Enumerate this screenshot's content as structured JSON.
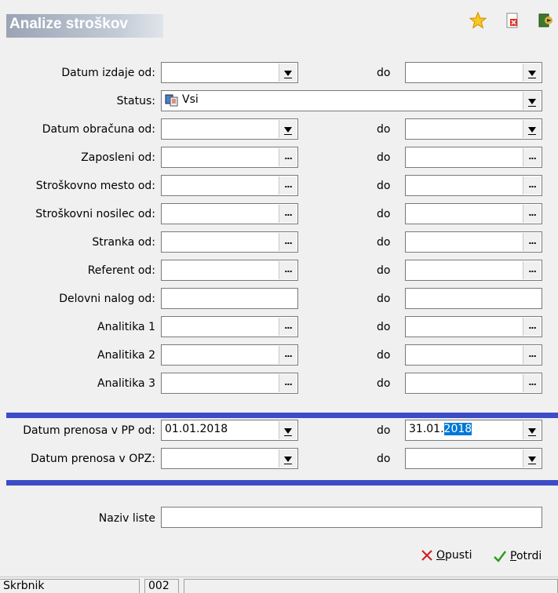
{
  "title": "Analize stroškov",
  "rows": [
    {
      "label": "Datum izdaje od:",
      "left": "",
      "right": "",
      "type": "dropdown"
    },
    {
      "label": "Status:",
      "left": "Vsi",
      "type": "status"
    },
    {
      "label": "Datum obračuna od:",
      "left": "",
      "right": "",
      "type": "dropdown"
    },
    {
      "label": "Zaposleni od:",
      "left": "",
      "right": "",
      "type": "ellipsis"
    },
    {
      "label": "Stroškovno mesto od:",
      "left": "",
      "right": "",
      "type": "ellipsis"
    },
    {
      "label": "Stroškovni nosilec od:",
      "left": "",
      "right": "",
      "type": "ellipsis"
    },
    {
      "label": "Stranka od:",
      "left": "",
      "right": "",
      "type": "ellipsis"
    },
    {
      "label": "Referent od:",
      "left": "",
      "right": "",
      "type": "ellipsis"
    },
    {
      "label": "Delovni nalog od:",
      "left": "",
      "right": "",
      "type": "text"
    },
    {
      "label": "Analitika 1",
      "left": "",
      "right": "",
      "type": "ellipsis"
    },
    {
      "label": "Analitika 2",
      "left": "",
      "right": "",
      "type": "ellipsis"
    },
    {
      "label": "Analitika 3",
      "left": "",
      "right": "",
      "type": "ellipsis"
    }
  ],
  "do_label": "do",
  "prenos_pp": {
    "label": "Datum prenosa v PP od:",
    "from": "01.01.2018",
    "to_prefix": "31.01.",
    "to_selected": "2018"
  },
  "prenos_opz": {
    "label": "Datum prenosa v OPZ:",
    "from": "",
    "to": ""
  },
  "naziv": {
    "label": "Naziv liste",
    "value": ""
  },
  "buttons": {
    "cancel_pre": "",
    "cancel_u": "O",
    "cancel_post": "pusti",
    "ok_pre": "",
    "ok_u": "P",
    "ok_post": "otrdi"
  },
  "statusbar": {
    "user": "Skrbnik",
    "code": "002"
  },
  "icons": {
    "star": "star-icon",
    "delete": "delete-icon",
    "exit": "exit-icon",
    "status": "status-list-icon"
  }
}
